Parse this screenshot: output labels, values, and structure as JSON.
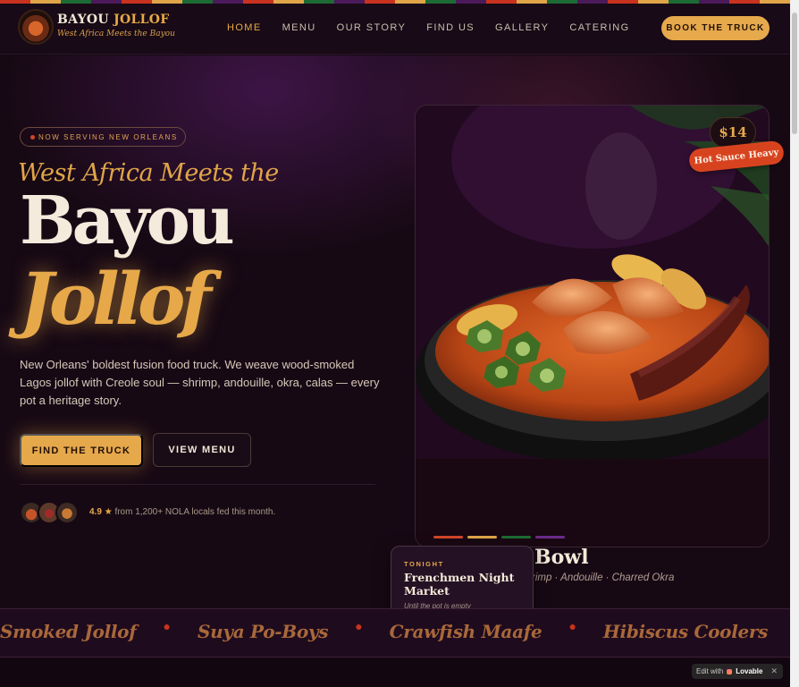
{
  "brand": {
    "name_part1": "BAYOU",
    "name_part2": "JOLLOF",
    "tagline": "West Africa Meets the Bayou"
  },
  "nav": {
    "links": [
      "HOME",
      "MENU",
      "OUR STORY",
      "FIND US",
      "GALLERY",
      "CATERING"
    ],
    "active": "HOME",
    "cta": "BOOK THE TRUCK"
  },
  "hero": {
    "pill": "NOW SERVING NEW ORLEANS",
    "script_line": "West Africa Meets the",
    "title_line1": "Bayou",
    "title_line2": "Jollof",
    "blurb": "New Orleans' boldest fusion food truck. We weave wood-smoked Lagos jollof with Creole soul — shrimp, andouille, okra, calas — every pot a heritage story.",
    "primary_button": "FIND THE TRUCK",
    "secondary_button": "VIEW MENU",
    "rating_score": "4.9",
    "rating_star": "★",
    "rating_text": "from 1,200+ NOLA locals fed this month."
  },
  "feature_card": {
    "price": "$14",
    "tag": "Hot Sauce Heavy",
    "dish_name": "Bowl",
    "dish_desc": "rimp · Andouille · Charred Okra",
    "stripe_colors": [
      "#d2452a",
      "#e0a548",
      "#1d6b34",
      "#6b2a8a"
    ]
  },
  "tonight": {
    "kicker": "TONIGHT",
    "title": "Frenchmen Night Market",
    "subtitle": "Until the pot is empty"
  },
  "marquee": {
    "items": [
      "Smoked Jollof",
      "Suya Po-Boys",
      "Crawfish Maafe",
      "Hibiscus Coolers"
    ],
    "separator": "●"
  },
  "badge": {
    "prefix": "Edit with",
    "brand": "Lovable",
    "close": "✕"
  },
  "colors": {
    "background": "#150813",
    "accent_gold": "#e6a849",
    "accent_red": "#d8431f",
    "text_cream": "#f5ebdc"
  }
}
